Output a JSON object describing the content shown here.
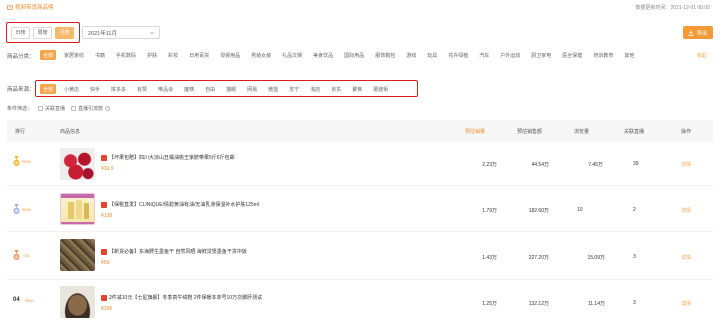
{
  "breadcrumb": "视频带货商品榜",
  "update_time": "数据更新时间：2021-12-01 00:00",
  "period_tabs": [
    {
      "label": "日榜",
      "active": false
    },
    {
      "label": "周榜",
      "active": false
    },
    {
      "label": "月榜",
      "active": true
    }
  ],
  "month_select": "2021年11月",
  "export_label": "导出",
  "category": {
    "label": "商品分类：",
    "collapse": "收起",
    "items": [
      {
        "label": "全部",
        "active": true
      },
      {
        "label": "家居家纺",
        "active": false
      },
      {
        "label": "书籍",
        "active": false
      },
      {
        "label": "手机数码",
        "active": false
      },
      {
        "label": "护肤",
        "active": false
      },
      {
        "label": "彩妆",
        "active": false
      },
      {
        "label": "日用百货",
        "active": false
      },
      {
        "label": "母婴用品",
        "active": false
      },
      {
        "label": "男装女装",
        "active": false
      },
      {
        "label": "礼品文娱",
        "active": false
      },
      {
        "label": "美食饮品",
        "active": false
      },
      {
        "label": "国际用品",
        "active": false
      },
      {
        "label": "服饰箱包",
        "active": false
      },
      {
        "label": "游戏",
        "active": false
      },
      {
        "label": "玩具",
        "active": false
      },
      {
        "label": "花卉绿植",
        "active": false
      },
      {
        "label": "汽车",
        "active": false
      },
      {
        "label": "户外运动",
        "active": false
      },
      {
        "label": "厨卫家电",
        "active": false
      },
      {
        "label": "医全保健",
        "active": false
      },
      {
        "label": "培训教育",
        "active": false
      },
      {
        "label": "其他",
        "active": false
      }
    ]
  },
  "source": {
    "label": "商品来源：",
    "items": [
      {
        "label": "全部",
        "active": true
      },
      {
        "label": "小黄店",
        "active": false
      },
      {
        "label": "快手",
        "active": false
      },
      {
        "label": "拼多多",
        "active": false
      },
      {
        "label": "有赞",
        "active": false
      },
      {
        "label": "唯品会",
        "active": false
      },
      {
        "label": "魔筷",
        "active": false
      },
      {
        "label": "自由",
        "active": false
      },
      {
        "label": "猫眼",
        "active": false
      },
      {
        "label": "网易",
        "active": false
      },
      {
        "label": "微盟",
        "active": false
      },
      {
        "label": "苏宁",
        "active": false
      },
      {
        "label": "淘店",
        "active": false
      },
      {
        "label": "京东",
        "active": false
      },
      {
        "label": "聚焦",
        "active": false
      },
      {
        "label": "蘑菇街",
        "active": false
      }
    ]
  },
  "filter": {
    "label": "条件筛选：",
    "options": [
      "关联直播",
      "直播引流款"
    ]
  },
  "table": {
    "headers": [
      "排行",
      "商品信息",
      "预估销量",
      "预估销售额",
      "浏览量",
      "关联直播",
      "操作"
    ],
    "rows": [
      {
        "rank": "01",
        "tag": "New",
        "title": "【坏果包赔】四川大凉山丑橘油桃王家脐带果5斤6斤包邮",
        "price": "¥19.9",
        "sales": "2.23万",
        "revenue": "44.54万",
        "views": "7.45万",
        "lives": "39",
        "action": "详情",
        "medal": "#f3b73b",
        "plat_color": "#e8422a"
      },
      {
        "rank": "02",
        "tag": "New",
        "title": "【保税直发】CLINIQUE/倩碧黄油有油/无油乳液保湿补水护肤125ml",
        "price": "¥138",
        "sales": "1.79万",
        "revenue": "182.60万",
        "views": "10",
        "lives": "2",
        "action": "详情",
        "medal": "#9fb4d8",
        "plat_color": "#e8422a"
      },
      {
        "rank": "03",
        "tag": "↑15",
        "title": "【新货必备】东海野生墨鱼干 自然风晒 海鲜烫煲墨鱼干货冲饭",
        "price": "¥59",
        "sales": "1.43万",
        "revenue": "227.20万",
        "views": "15.09万",
        "lives": "3",
        "action": "详情",
        "medal": "#e89a6a",
        "plat_color": "#e8422a"
      },
      {
        "rank": "04",
        "tag": "New",
        "title": "2件减10元【七星旗舰】冬季真牛绒鞋 2件保暖本单号10万次脚肝测试",
        "price": "¥196",
        "sales": "1.25万",
        "revenue": "132.12万",
        "views": "11.14万",
        "lives": "3",
        "action": "详情",
        "medal": "",
        "plat_color": "#e8422a"
      }
    ]
  }
}
